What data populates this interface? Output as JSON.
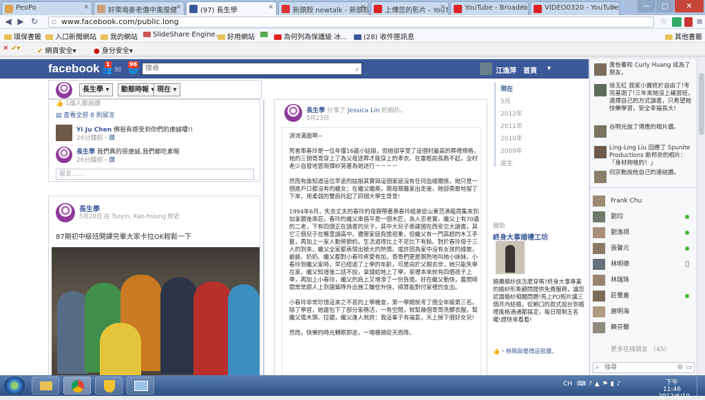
{
  "tabs": [
    {
      "label": "PeoPo",
      "color": "#d9a44d"
    },
    {
      "label": "好萊塢麥老傷中風復健",
      "color": "#c9a07a"
    },
    {
      "label": "(97) 長生學",
      "color": "#3b5998"
    },
    {
      "label": "新頭殼 newtalk - 新頭殼",
      "color": "#d33"
    },
    {
      "label": "上傳您的影片 - YouTube",
      "color": "#d22"
    },
    {
      "label": "YouTube - Broadcast Yo",
      "color": "#d22"
    },
    {
      "label": "VIDEO0320 - YouTube",
      "color": "#d22"
    }
  ],
  "address": {
    "url": "www.facebook.com/public.long"
  },
  "bookmarks": [
    {
      "label": "環保書籤"
    },
    {
      "label": "入口新聞網站"
    },
    {
      "label": "我的網站"
    },
    {
      "label": "SlideShare Engine..."
    },
    {
      "label": "好用網站"
    },
    {
      "label": "為何列為保護級 冰..."
    },
    {
      "label": "(28) 收件匣訊息"
    },
    {
      "label": "其他書籤"
    }
  ],
  "safety": {
    "label1": "網頁安全",
    "label2": "身分安全"
  },
  "fb": {
    "logo": "facebook",
    "badge1": "1",
    "badge2": "96",
    "search_placeholder": "搜尋",
    "user": "江逸萍",
    "home": "首頁",
    "subheader": {
      "page": "長生學",
      "activity": "動態時報",
      "now": "現在"
    }
  },
  "post1": {
    "top_snip": "1個人都說讚",
    "view_all": "查看全部 8 則留言",
    "comments": [
      {
        "name": "Yi Ju Chen",
        "text": "佛祖有感受到你們的虔誠嘍!!",
        "time": "26分鐘前",
        "like": "讚"
      },
      {
        "name": "長生學",
        "text": "我們真的很虔誠,我們都吃素喔",
        "time": "26分鐘前",
        "like": "讚"
      }
    ],
    "comment_placeholder": "留言……"
  },
  "post2": {
    "name": "長生學",
    "meta": "5月20日 在 Tsoyin, Kao-hsiung 附近",
    "text": "87期初中級班開課完畢大家卡拉OK輕鬆一下"
  },
  "post3": {
    "name": "長生學",
    "share": "分享了",
    "shared_user": "Jessica Lin",
    "share_tail": "的相片。",
    "date": "5月23日",
    "paras": [
      "淚流滿面啊~",
      "死者串春玲是一位年僅16歲小姑娘，但她卻享受了這個村最高的葬禮規格，她的三個哥哥穿上了為父母送葬才能穿上的孝衣。在靈柩前長跪不起，全村老少自發地冒雨揮紗哭著為她送行－－－－",
      "然而有誰知道這位早逝的姑娘其實與這個家庭沒有任何血緣關係，她只是一個進戶口都沒有的繼女；在繼父癱瘓，親母親離家出走後，她卻勇敢地留了下來，用柔弱的雙肩托起了四個大學生哥哥!",
      "1994年6月，失去丈夫的春玲的母親帶著串春玲組弟從山東范濤龍周集來到加拿勝後串莊，春玲的繼父串倡平是一個木匠，為人忠老實。繼父上有70歲的二老，下有四個正在讀書的兒子。其中大兒子串建國在西安交大讀書，其它三個兒子在縣里讀高中。儘管家庭負擔很重，但繼父有一門高超的木工手藝，再加上一家人勤勞節約，生活過得比上不足比下有餘。對於春玲母子三人的到來，繼父全家都表現出極大的熱情。或許因為家中沒有女孩的緣故，爺爺、奶奶、繼父都對小春玲疼愛有加，哥哥們更是親熱地叫她小妹妹。小春玲到繼父家時，早已經過了上學的年齡，可是由於父親去世，她只能失學在家。繼父知道後二話不說，拿錢給她上了學。家裡本來就有四個孩子上學，再加上小春玲，繼父的肩上又增添了一份負擔。好在繼父勤快，農閒時間常常跟人上到建築隊外出施工賺些外快，總算能對付家裡的支出。",
      "小春玲非常珍惜這來之不易的上學機會，第一學期就考了個全年級第三名。除了學習，她還包下了部分家務活，一有空閒，就幫幾個哥哥洗髒衣服，幫繼父擔木頭、拉鋸，繼父逢人就誇：我這輩子有福氣，天上掉下個好女兒!",
      "然而，快樂的時光轉眼即逝，一場橫禍從天而降。"
    ]
  },
  "timeline": [
    "現在",
    "5月",
    "2012年",
    "2011年",
    "2010年",
    "2009年",
    "誕生"
  ],
  "ad": {
    "heading": "贊助",
    "title": "終身大事婚禮工坊",
    "body": "婚攝婚紗該怎麼穿嗎?終身大事專業的婚紗形象顧問提供免費服務，讓您認識婚紗相關問題!馬上PO照片讓三個月內結婚，從飽口的款式設計到婚禮風格通通都搞定，每日限制五名曜!趕快來看看!",
    "like": "・林珮與覺得這很讚。"
  },
  "ticker": [
    {
      "text": "黃怡蓁和 Curly Huang 成為了朋友。"
    },
    {
      "text": "徐玉紅 我家小寶終於自由了!考完基測了!三年來她沒上補習班，選擇自己的方式讀書，只希望她快樂學習，安全幸福長大!"
    },
    {
      "text": "谷明光說了博應的相片讚。"
    },
    {
      "text": "Ling-Ling Liu 回應了 Spunite Productions 斯邦奈的相片：「身材夠嗆的！」"
    },
    {
      "text": "何宗勳說他自己的連結讚。"
    }
  ],
  "chat": [
    {
      "name": "Frank Chu",
      "online": false
    },
    {
      "name": "劉均",
      "online": true
    },
    {
      "name": "劉逸祺",
      "online": true
    },
    {
      "name": "張馨元",
      "online": true
    },
    {
      "name": "林明德",
      "online": false
    },
    {
      "name": "林瑞珠",
      "online": false
    },
    {
      "name": "莊豐嘉",
      "online": true
    },
    {
      "name": "謝明海",
      "online": false
    },
    {
      "name": "賴芬蘭",
      "online": false
    }
  ],
  "chat_more": "更多在線朋友 （45）",
  "chat_search": "搜尋",
  "taskbar": {
    "lang": "CH",
    "time": "下午 11:46",
    "date": "2012/6/10"
  }
}
